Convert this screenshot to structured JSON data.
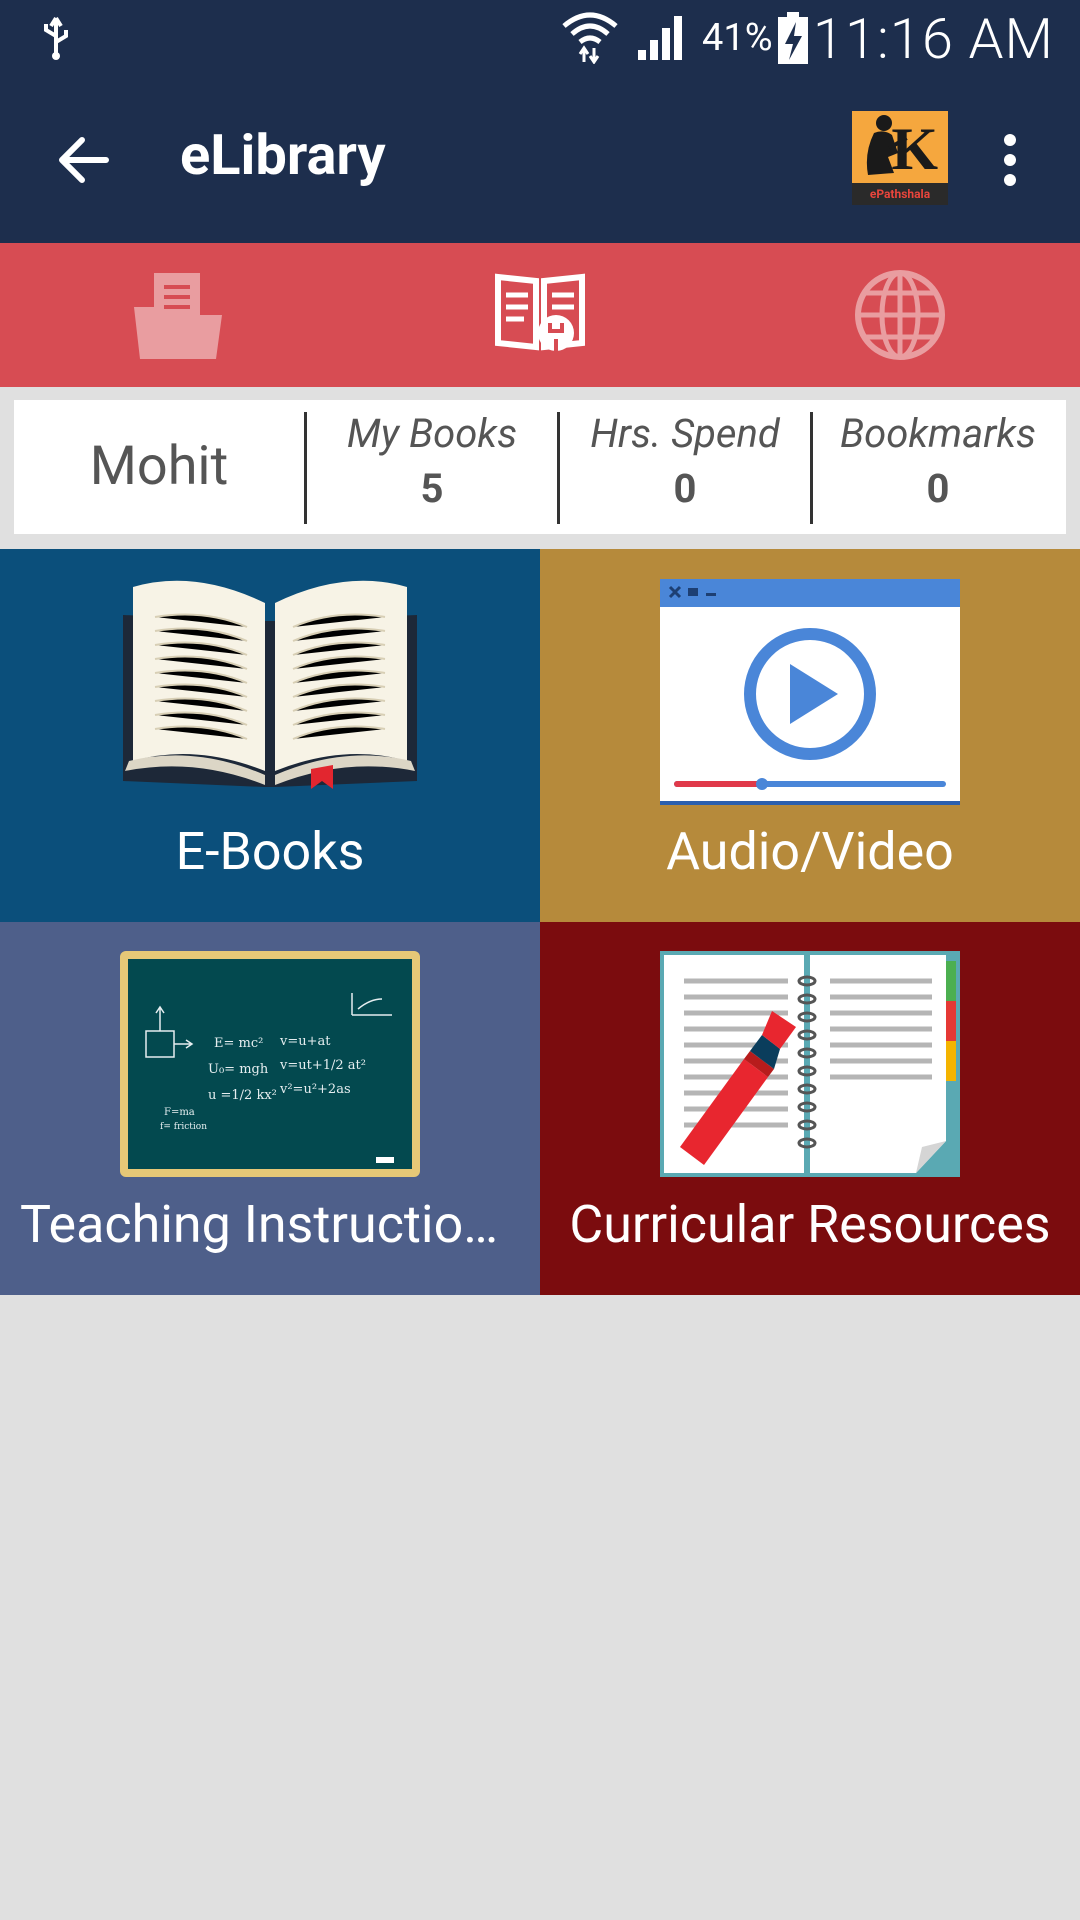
{
  "status_bar": {
    "battery_percent": "41%",
    "time": "11:16 AM"
  },
  "app_bar": {
    "title": "eLibrary",
    "logo_letter": "K",
    "logo_tagline": "ePathshala"
  },
  "tabs": [
    {
      "icon": "folder-document-icon"
    },
    {
      "icon": "book-plug-icon"
    },
    {
      "icon": "globe-icon"
    }
  ],
  "stats": {
    "user_name": "Mohit",
    "my_books_label": "My Books",
    "my_books_value": "5",
    "hrs_spend_label": "Hrs. Spend",
    "hrs_spend_value": "0",
    "bookmarks_label": "Bookmarks",
    "bookmarks_value": "0"
  },
  "tiles": {
    "ebooks": "E-Books",
    "audio_video": "Audio/Video",
    "teaching": "Teaching Instructional Materials",
    "curricular": "Curricular Resources"
  },
  "chalkboard": {
    "line1": "E= mc²",
    "line2": "U₀= mgh",
    "line3": "u =1/2 kx²",
    "line4": "v=u+at",
    "line5": "v=ut+1/2 at²",
    "line6": "v²=u²+2as",
    "line7": "F=ma",
    "line8": "f= friction"
  },
  "colors": {
    "header": "#1d2e4d",
    "tab_strip": "#d74c53",
    "ebooks": "#0b4f7b",
    "audio_video": "#b68a3b",
    "teaching": "#4e5f8a",
    "curricular": "#7b0c0e"
  }
}
